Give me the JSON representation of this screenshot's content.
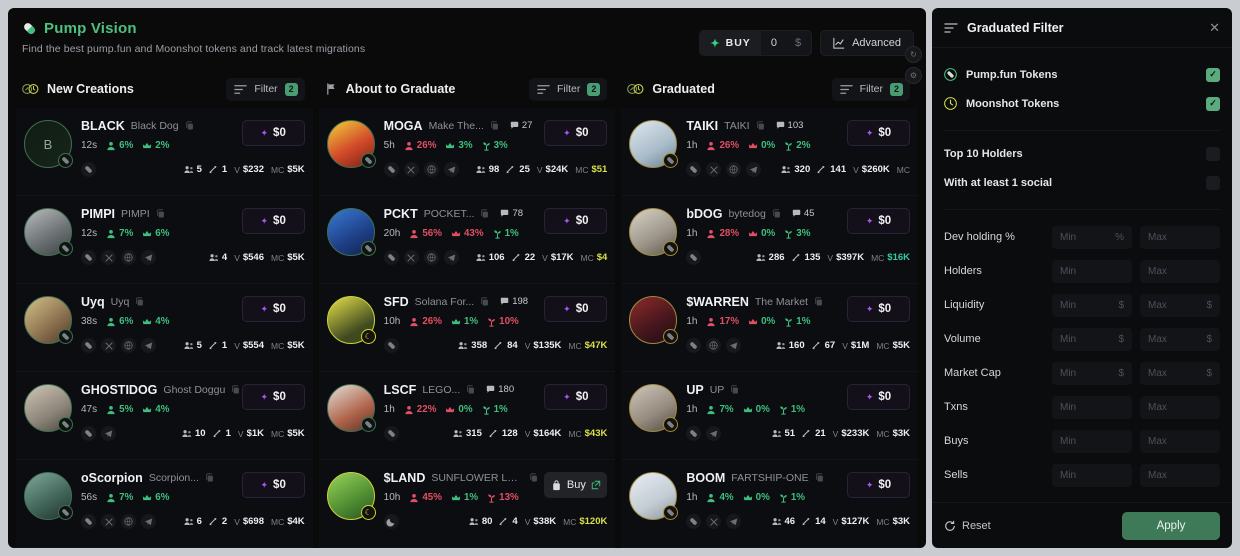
{
  "app": {
    "brand_title": "Pump Vision",
    "brand_icon": "pill-icon",
    "subtitle": "Find the best pump.fun and Moonshot tokens and track latest migrations",
    "buy": {
      "label": "BUY",
      "value": "0",
      "currency": "$",
      "bolt": "✦"
    },
    "advanced": {
      "label": "Advanced",
      "icon": "chart-line-icon"
    }
  },
  "columns": [
    {
      "icon": "pump-moonshot-icon",
      "title": "New Creations",
      "filter_label": "Filter",
      "filter_count": "2",
      "cards": [
        {
          "symbol": "BLACK",
          "name": "Black Dog",
          "avatar_letter": "B",
          "ring": "green",
          "age": "12s",
          "holder_pct": "6%",
          "holder_dir": "up",
          "top_pct": "2%",
          "third_pct": "",
          "comments": "",
          "socials": [
            "pill"
          ],
          "users": "5",
          "trades": "1",
          "vol_key": "V",
          "vol": "$232",
          "mc_key": "MC",
          "mc": "$5K",
          "mc_color": "white",
          "action": {
            "type": "amount",
            "label": "$0"
          }
        },
        {
          "symbol": "PIMPI",
          "name": "PIMPI",
          "avatar_letter": "",
          "ring": "green",
          "age": "12s",
          "holder_pct": "7%",
          "holder_dir": "up",
          "top_pct": "6%",
          "third_pct": "",
          "comments": "",
          "socials": [
            "pill",
            "x",
            "globe",
            "telegram"
          ],
          "users": "4",
          "trades": "",
          "vol_key": "V",
          "vol": "$546",
          "mc_key": "MC",
          "mc": "$5K",
          "mc_color": "white",
          "action": {
            "type": "amount",
            "label": "$0"
          }
        },
        {
          "symbol": "Uyq",
          "name": "Uyq",
          "avatar_letter": "",
          "ring": "green",
          "age": "38s",
          "holder_pct": "6%",
          "holder_dir": "up",
          "top_pct": "4%",
          "third_pct": "",
          "comments": "",
          "socials": [
            "pill",
            "x",
            "globe",
            "telegram"
          ],
          "users": "5",
          "trades": "1",
          "vol_key": "V",
          "vol": "$554",
          "mc_key": "MC",
          "mc": "$5K",
          "mc_color": "white",
          "action": {
            "type": "amount",
            "label": "$0"
          }
        },
        {
          "symbol": "GHOSTIDOG",
          "name": "Ghost Doggu",
          "avatar_letter": "",
          "ring": "green",
          "age": "47s",
          "holder_pct": "5%",
          "holder_dir": "up",
          "top_pct": "4%",
          "third_pct": "",
          "comments": "",
          "socials": [
            "pill",
            "telegram"
          ],
          "users": "10",
          "trades": "1",
          "vol_key": "V",
          "vol": "$1K",
          "mc_key": "MC",
          "mc": "$5K",
          "mc_color": "white",
          "action": {
            "type": "amount",
            "label": "$0"
          }
        },
        {
          "symbol": "oScorpion",
          "name": "Scorpion...",
          "avatar_letter": "",
          "ring": "green",
          "age": "56s",
          "holder_pct": "7%",
          "holder_dir": "up",
          "top_pct": "6%",
          "third_pct": "",
          "comments": "",
          "socials": [
            "pill",
            "x",
            "globe",
            "telegram"
          ],
          "users": "6",
          "trades": "2",
          "vol_key": "V",
          "vol": "$698",
          "mc_key": "MC",
          "mc": "$4K",
          "mc_color": "white",
          "action": {
            "type": "amount",
            "label": "$0"
          }
        }
      ]
    },
    {
      "icon": "flag-icon",
      "title": "About to Graduate",
      "filter_label": "Filter",
      "filter_count": "2",
      "cards": [
        {
          "symbol": "MOGA",
          "name": "Make The...",
          "avatar_letter": "",
          "ring": "green",
          "age": "5h",
          "holder_pct": "26%",
          "holder_dir": "down",
          "top_pct": "3%",
          "third_pct": "3%",
          "comments": "27",
          "socials": [
            "pill",
            "x",
            "globe",
            "telegram"
          ],
          "users": "98",
          "trades": "25",
          "vol_key": "V",
          "vol": "$24K",
          "mc_key": "MC",
          "mc": "$51",
          "mc_color": "yellow",
          "action": {
            "type": "amount",
            "label": "$0"
          }
        },
        {
          "symbol": "PCKT",
          "name": "POCKET...",
          "avatar_letter": "",
          "ring": "green",
          "age": "20h",
          "holder_pct": "56%",
          "holder_dir": "down",
          "top_pct": "43%",
          "third_pct": "1%",
          "comments": "78",
          "socials": [
            "pill",
            "x",
            "globe",
            "telegram"
          ],
          "users": "106",
          "trades": "22",
          "vol_key": "V",
          "vol": "$17K",
          "mc_key": "MC",
          "mc": "$4",
          "mc_color": "yellow",
          "action": {
            "type": "amount",
            "label": "$0"
          }
        },
        {
          "symbol": "SFD",
          "name": "Solana For...",
          "avatar_letter": "",
          "ring": "yellow",
          "age": "10h",
          "holder_pct": "26%",
          "holder_dir": "down",
          "top_pct": "1%",
          "third_pct": "10%",
          "comments": "198",
          "socials": [
            "pill"
          ],
          "users": "358",
          "trades": "84",
          "vol_key": "V",
          "vol": "$135K",
          "mc_key": "MC",
          "mc": "$47K",
          "mc_color": "yellow",
          "action": {
            "type": "amount",
            "label": "$0"
          }
        },
        {
          "symbol": "LSCF",
          "name": "LEGO...",
          "avatar_letter": "",
          "ring": "green",
          "age": "1h",
          "holder_pct": "22%",
          "holder_dir": "down",
          "top_pct": "0%",
          "third_pct": "1%",
          "comments": "180",
          "socials": [
            "pill"
          ],
          "users": "315",
          "trades": "128",
          "vol_key": "V",
          "vol": "$164K",
          "mc_key": "MC",
          "mc": "$43K",
          "mc_color": "yellow",
          "action": {
            "type": "amount",
            "label": "$0"
          }
        },
        {
          "symbol": "$LAND",
          "name": "SUNFLOWER LAND",
          "avatar_letter": "",
          "ring": "yellow",
          "age": "10h",
          "holder_pct": "45%",
          "holder_dir": "down",
          "top_pct": "1%",
          "third_pct": "13%",
          "comments": "",
          "socials": [
            "moon"
          ],
          "users": "80",
          "trades": "4",
          "vol_key": "V",
          "vol": "$38K",
          "mc_key": "MC",
          "mc": "$120K",
          "mc_color": "yellow",
          "action": {
            "type": "buy",
            "label": "Buy"
          }
        }
      ]
    },
    {
      "icon": "pump-moonshot-icon",
      "title": "Graduated",
      "filter_label": "Filter",
      "filter_count": "2",
      "cards": [
        {
          "symbol": "TAIKI",
          "name": "TAIKI",
          "avatar_letter": "",
          "ring": "gold",
          "age": "1h",
          "holder_pct": "26%",
          "holder_dir": "down",
          "top_pct": "0%",
          "third_pct": "2%",
          "comments": "103",
          "socials": [
            "pill",
            "x",
            "globe",
            "telegram"
          ],
          "users": "320",
          "trades": "141",
          "vol_key": "V",
          "vol": "$260K",
          "mc_key": "MC",
          "mc": "",
          "mc_color": "white",
          "action": {
            "type": "amount",
            "label": "$0"
          }
        },
        {
          "symbol": "bDOG",
          "name": "bytedog",
          "avatar_letter": "",
          "ring": "gold",
          "age": "1h",
          "holder_pct": "28%",
          "holder_dir": "down",
          "top_pct": "0%",
          "third_pct": "3%",
          "comments": "45",
          "socials": [
            "pill"
          ],
          "users": "286",
          "trades": "135",
          "vol_key": "V",
          "vol": "$397K",
          "mc_key": "MC",
          "mc": "$16K",
          "mc_color": "teal",
          "action": {
            "type": "amount",
            "label": "$0"
          }
        },
        {
          "symbol": "$WARREN",
          "name": "The Market",
          "avatar_letter": "",
          "ring": "gold",
          "age": "1h",
          "holder_pct": "17%",
          "holder_dir": "down",
          "top_pct": "0%",
          "third_pct": "1%",
          "comments": "",
          "socials": [
            "pill",
            "globe",
            "telegram"
          ],
          "users": "160",
          "trades": "67",
          "vol_key": "V",
          "vol": "$1M",
          "mc_key": "MC",
          "mc": "$5K",
          "mc_color": "white",
          "action": {
            "type": "amount",
            "label": "$0"
          }
        },
        {
          "symbol": "UP",
          "name": "UP",
          "avatar_letter": "",
          "ring": "gold",
          "age": "1h",
          "holder_pct": "7%",
          "holder_dir": "up",
          "top_pct": "0%",
          "third_pct": "1%",
          "comments": "",
          "socials": [
            "pill",
            "telegram"
          ],
          "users": "51",
          "trades": "21",
          "vol_key": "V",
          "vol": "$233K",
          "mc_key": "MC",
          "mc": "$3K",
          "mc_color": "white",
          "action": {
            "type": "amount",
            "label": "$0"
          }
        },
        {
          "symbol": "BOOM",
          "name": "FARTSHIP-ONE",
          "avatar_letter": "",
          "ring": "gold",
          "age": "1h",
          "holder_pct": "4%",
          "holder_dir": "up",
          "top_pct": "0%",
          "third_pct": "1%",
          "comments": "",
          "socials": [
            "pill",
            "x",
            "telegram"
          ],
          "users": "46",
          "trades": "14",
          "vol_key": "V",
          "vol": "$127K",
          "mc_key": "MC",
          "mc": "$3K",
          "mc_color": "white",
          "action": {
            "type": "amount",
            "label": "$0"
          }
        }
      ]
    }
  ],
  "panel": {
    "title": "Graduated Filter",
    "close_icon": "close-icon",
    "toggles": [
      {
        "label": "Pump.fun Tokens",
        "icon": "pump-icon",
        "checked": true,
        "mark": "✓"
      },
      {
        "label": "Moonshot Tokens",
        "icon": "moonshot-icon",
        "checked": true,
        "mark": "✓"
      },
      {
        "label": "Top 10 Holders",
        "icon": "",
        "checked": false,
        "mark": ""
      },
      {
        "label": "With at least 1 social",
        "icon": "",
        "checked": false,
        "mark": ""
      }
    ],
    "ranges": [
      {
        "label": "Dev holding %",
        "min_ph": "Min",
        "max_ph": "Max",
        "min_suffix": "%",
        "max_suffix": ""
      },
      {
        "label": "Holders",
        "min_ph": "Min",
        "max_ph": "Max",
        "min_suffix": "",
        "max_suffix": ""
      },
      {
        "label": "Liquidity",
        "min_ph": "Min",
        "max_ph": "Max",
        "min_suffix": "$",
        "max_suffix": "$"
      },
      {
        "label": "Volume",
        "min_ph": "Min",
        "max_ph": "Max",
        "min_suffix": "$",
        "max_suffix": "$"
      },
      {
        "label": "Market Cap",
        "min_ph": "Min",
        "max_ph": "Max",
        "min_suffix": "$",
        "max_suffix": "$"
      },
      {
        "label": "Txns",
        "min_ph": "Min",
        "max_ph": "Max",
        "min_suffix": "",
        "max_suffix": ""
      },
      {
        "label": "Buys",
        "min_ph": "Min",
        "max_ph": "Max",
        "min_suffix": "",
        "max_suffix": ""
      },
      {
        "label": "Sells",
        "min_ph": "Min",
        "max_ph": "Max",
        "min_suffix": "",
        "max_suffix": ""
      }
    ],
    "reset_label": "Reset",
    "apply_label": "Apply"
  },
  "colors": {
    "accent_green": "#4ec07f",
    "badge_green": "#4a9d72",
    "purple": "#a855f7",
    "yellow": "#d8e04a",
    "teal": "#35c9a5",
    "red": "#e04f63",
    "bg": "#0a0a0b"
  }
}
